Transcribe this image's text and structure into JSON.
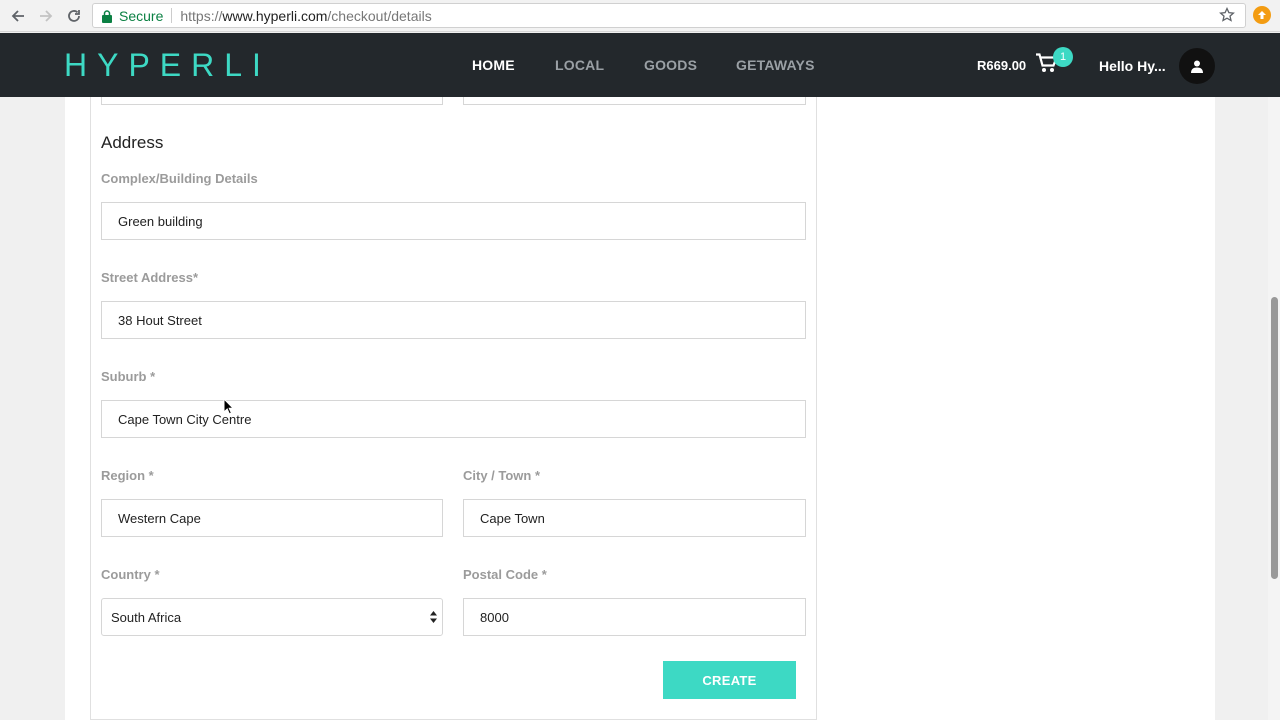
{
  "browser": {
    "secure_label": "Secure",
    "url_scheme": "https://",
    "url_host": "www.hyperli.com",
    "url_path": "/checkout/details"
  },
  "header": {
    "logo": "HYPERLI",
    "nav": [
      "HOME",
      "LOCAL",
      "GOODS",
      "GETAWAYS"
    ],
    "cart_total": "R669.00",
    "cart_count": "1",
    "greeting": "Hello Hy..."
  },
  "form": {
    "section_title": "Address",
    "complex": {
      "label": "Complex/Building Details",
      "value": "Green building"
    },
    "street": {
      "label": "Street Address*",
      "value": "38 Hout Street"
    },
    "suburb": {
      "label": "Suburb *",
      "value": "Cape Town City Centre"
    },
    "region": {
      "label": "Region *",
      "value": "Western Cape"
    },
    "city": {
      "label": "City / Town *",
      "value": "Cape Town"
    },
    "country": {
      "label": "Country *",
      "value": "South Africa"
    },
    "postal": {
      "label": "Postal Code *",
      "value": "8000"
    },
    "submit_label": "CREATE"
  },
  "colors": {
    "accent": "#3dd9c4",
    "header_bg": "#23282c",
    "label": "#9b9b9b"
  }
}
